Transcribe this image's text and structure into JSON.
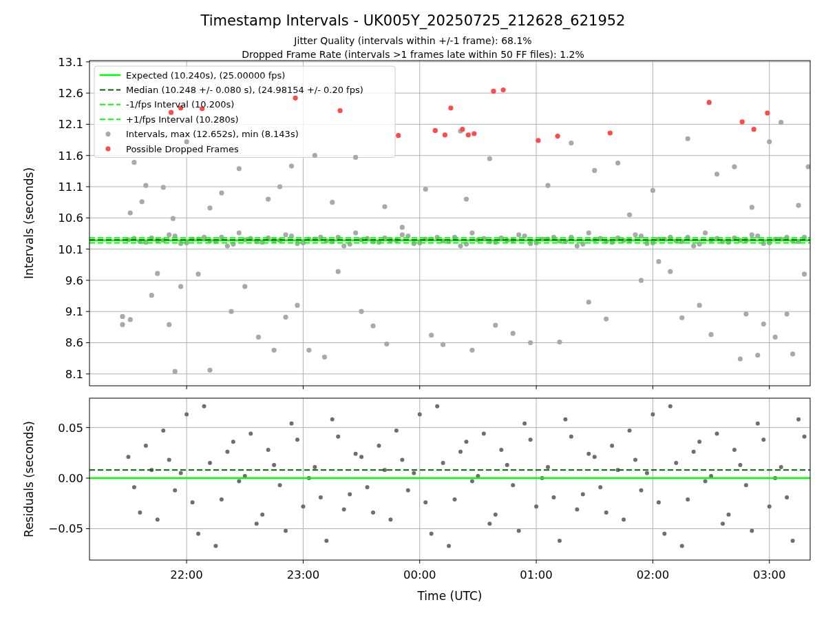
{
  "figure": {
    "title": "Timestamp Intervals - UK005Y_20250725_212628_621952",
    "subtitles": [
      "Jitter Quality (intervals within +/-1 frame): 68.1%",
      "Dropped Frame Rate (intervals >1 frames late within 50 FF files): 1.2%"
    ]
  },
  "charts": [
    {
      "chart_data": {
        "type": "scatter",
        "ylabel": "Intervals (seconds)",
        "grid": true,
        "legend": "upper left",
        "xlim": [
          "2025-07-25T21:10",
          "2025-07-26T03:21"
        ],
        "ylim": [
          7.91,
          13.12
        ],
        "yticks": [
          {
            "value": 8.1,
            "label": "8.1"
          },
          {
            "value": 8.6,
            "label": "8.6"
          },
          {
            "value": 9.1,
            "label": "9.1"
          },
          {
            "value": 9.6,
            "label": "9.6"
          },
          {
            "value": 10.1,
            "label": "10.1"
          },
          {
            "value": 10.6,
            "label": "10.6"
          },
          {
            "value": 11.1,
            "label": "11.1"
          },
          {
            "value": 11.6,
            "label": "11.6"
          },
          {
            "value": 12.1,
            "label": "12.1"
          },
          {
            "value": 12.6,
            "label": "12.6"
          },
          {
            "value": 13.1,
            "label": "13.1"
          }
        ],
        "ref_lines": [
          {
            "axis": "y",
            "value": 10.24,
            "label": "Expected (10.240s), (25.00000 fps)",
            "color": "#00ff00"
          },
          {
            "axis": "y",
            "value": 10.248,
            "label": "Median (10.248 +/- 0.080 s), (24.98154 +/- 0.20 fps)",
            "color": "#006400"
          },
          {
            "axis": "y",
            "value": 10.2,
            "label": "-1/fps Interval (10.200s)",
            "color": "#00ff00"
          },
          {
            "axis": "y",
            "value": 10.28,
            "label": "+1/fps Interval (10.280s)",
            "color": "#00ff00"
          }
        ],
        "series": [
          {
            "name": "Intervals, max (12.652s), min (8.143s)",
            "color": "#a9a9a9",
            "x": [
              "2025-07-25T21:27",
              "2025-07-25T21:27",
              "2025-07-25T21:31",
              "2025-07-25T21:31",
              "2025-07-25T21:33",
              "2025-07-25T21:37",
              "2025-07-25T21:39",
              "2025-07-25T21:42",
              "2025-07-25T21:45",
              "2025-07-25T21:48",
              "2025-07-25T21:51",
              "2025-07-25T21:53",
              "2025-07-25T21:54",
              "2025-07-25T21:57",
              "2025-07-25T22:00",
              "2025-07-25T22:06",
              "2025-07-25T22:12",
              "2025-07-25T22:12",
              "2025-07-25T22:18",
              "2025-07-25T22:23",
              "2025-07-25T22:27",
              "2025-07-25T22:30",
              "2025-07-25T22:37",
              "2025-07-25T22:42",
              "2025-07-25T22:45",
              "2025-07-25T22:48",
              "2025-07-25T22:51",
              "2025-07-25T22:54",
              "2025-07-25T22:57",
              "2025-07-25T23:03",
              "2025-07-25T23:06",
              "2025-07-25T23:11",
              "2025-07-25T23:15",
              "2025-07-25T23:18",
              "2025-07-25T23:27",
              "2025-07-25T23:30",
              "2025-07-25T23:36",
              "2025-07-25T23:42",
              "2025-07-25T23:43",
              "2025-07-25T23:51",
              "2025-07-26T00:03",
              "2025-07-26T00:06",
              "2025-07-26T00:12",
              "2025-07-26T00:21",
              "2025-07-26T00:24",
              "2025-07-26T00:27",
              "2025-07-26T00:36",
              "2025-07-26T00:39",
              "2025-07-26T00:48",
              "2025-07-26T00:57",
              "2025-07-26T01:06",
              "2025-07-26T01:12",
              "2025-07-26T01:18",
              "2025-07-26T01:27",
              "2025-07-26T01:30",
              "2025-07-26T01:36",
              "2025-07-26T01:42",
              "2025-07-26T01:48",
              "2025-07-26T01:54",
              "2025-07-26T02:00",
              "2025-07-26T02:03",
              "2025-07-26T02:09",
              "2025-07-26T02:15",
              "2025-07-26T02:18",
              "2025-07-26T02:24",
              "2025-07-26T02:30",
              "2025-07-26T02:33",
              "2025-07-26T02:42",
              "2025-07-26T02:45",
              "2025-07-26T02:48",
              "2025-07-26T02:51",
              "2025-07-26T02:54",
              "2025-07-26T02:57",
              "2025-07-26T03:00",
              "2025-07-26T03:03",
              "2025-07-26T03:06",
              "2025-07-26T03:09",
              "2025-07-26T03:12",
              "2025-07-26T03:15",
              "2025-07-26T03:18",
              "2025-07-26T03:20",
              "2025-07-25T21:30",
              "2025-07-25T21:36",
              "2025-07-25T21:42",
              "2025-07-25T21:48",
              "2025-07-25T21:54",
              "2025-07-25T22:00",
              "2025-07-25T22:06",
              "2025-07-25T22:12",
              "2025-07-25T22:18",
              "2025-07-25T22:24",
              "2025-07-25T22:30",
              "2025-07-25T22:36",
              "2025-07-25T22:42",
              "2025-07-25T22:48",
              "2025-07-25T22:54",
              "2025-07-25T23:00",
              "2025-07-25T23:06",
              "2025-07-25T23:12",
              "2025-07-25T23:18",
              "2025-07-25T23:24",
              "2025-07-25T23:30",
              "2025-07-25T23:36",
              "2025-07-25T23:42",
              "2025-07-25T23:48",
              "2025-07-25T23:54",
              "2025-07-26T00:00",
              "2025-07-26T00:06",
              "2025-07-26T00:12",
              "2025-07-26T00:18",
              "2025-07-26T00:24",
              "2025-07-26T00:30",
              "2025-07-26T00:36",
              "2025-07-26T00:42",
              "2025-07-26T00:48",
              "2025-07-26T00:54",
              "2025-07-26T01:00",
              "2025-07-26T01:06",
              "2025-07-26T01:12",
              "2025-07-26T01:18",
              "2025-07-26T01:24",
              "2025-07-26T01:30",
              "2025-07-26T01:36",
              "2025-07-26T01:42",
              "2025-07-26T01:48",
              "2025-07-26T01:54",
              "2025-07-26T02:00",
              "2025-07-26T02:06",
              "2025-07-26T02:12",
              "2025-07-26T02:18",
              "2025-07-26T02:24",
              "2025-07-26T02:30",
              "2025-07-26T02:36",
              "2025-07-26T02:42",
              "2025-07-26T02:48",
              "2025-07-26T02:54",
              "2025-07-26T03:00",
              "2025-07-26T03:06",
              "2025-07-26T03:12",
              "2025-07-26T03:18",
              "2025-07-25T21:33",
              "2025-07-25T21:39",
              "2025-07-25T21:45",
              "2025-07-25T21:51",
              "2025-07-25T21:57",
              "2025-07-25T22:03",
              "2025-07-25T22:09",
              "2025-07-25T22:15",
              "2025-07-25T22:21",
              "2025-07-25T22:27",
              "2025-07-25T22:33",
              "2025-07-25T22:39",
              "2025-07-25T22:45",
              "2025-07-25T22:51",
              "2025-07-25T22:57",
              "2025-07-25T23:03",
              "2025-07-25T23:09",
              "2025-07-25T23:15",
              "2025-07-25T23:21",
              "2025-07-25T23:27",
              "2025-07-25T23:33",
              "2025-07-25T23:39",
              "2025-07-25T23:45",
              "2025-07-25T23:51",
              "2025-07-25T23:57",
              "2025-07-26T00:03",
              "2025-07-26T00:09",
              "2025-07-26T00:15",
              "2025-07-26T00:21",
              "2025-07-26T00:27",
              "2025-07-26T00:33",
              "2025-07-26T00:39",
              "2025-07-26T00:45",
              "2025-07-26T00:51",
              "2025-07-26T00:57",
              "2025-07-26T01:03",
              "2025-07-26T01:09",
              "2025-07-26T01:15",
              "2025-07-26T01:21",
              "2025-07-26T01:27",
              "2025-07-26T01:33",
              "2025-07-26T01:39",
              "2025-07-26T01:45",
              "2025-07-26T01:51",
              "2025-07-26T01:57",
              "2025-07-26T02:03",
              "2025-07-26T02:09",
              "2025-07-26T02:15",
              "2025-07-26T02:21",
              "2025-07-26T02:27",
              "2025-07-26T02:33",
              "2025-07-26T02:39",
              "2025-07-26T02:45",
              "2025-07-26T02:51",
              "2025-07-26T02:57",
              "2025-07-26T03:03",
              "2025-07-26T03:09",
              "2025-07-26T03:15"
            ],
            "values": [
              9.02,
              8.89,
              8.97,
              10.68,
              11.49,
              10.86,
              11.12,
              9.36,
              9.71,
              11.09,
              8.89,
              10.59,
              8.14,
              9.5,
              11.82,
              9.7,
              8.16,
              10.76,
              11.0,
              9.1,
              11.39,
              9.5,
              8.69,
              10.9,
              8.48,
              11.1,
              9.01,
              11.43,
              9.2,
              8.48,
              11.6,
              8.37,
              10.85,
              9.74,
              11.57,
              9.1,
              8.87,
              10.78,
              8.58,
              10.45,
              11.06,
              8.72,
              8.57,
              11.99,
              10.9,
              8.48,
              11.55,
              8.88,
              8.75,
              8.6,
              11.12,
              8.61,
              11.8,
              9.25,
              11.36,
              8.98,
              11.48,
              10.65,
              9.6,
              11.04,
              9.9,
              9.74,
              9.0,
              11.87,
              9.2,
              8.73,
              11.3,
              11.42,
              8.34,
              9.06,
              10.77,
              8.4,
              8.9,
              11.82,
              8.69,
              12.13,
              9.06,
              8.42,
              10.8,
              9.7,
              11.42,
              10.25,
              10.22,
              10.28,
              10.24,
              10.31,
              10.2,
              10.26,
              10.23,
              10.29,
              10.18,
              10.25,
              10.22,
              10.28,
              10.24,
              10.31,
              10.2,
              10.26,
              10.23,
              10.29,
              10.18,
              10.25,
              10.22,
              10.28,
              10.24,
              10.31,
              10.2,
              10.26,
              10.23,
              10.29,
              10.18,
              10.25,
              10.22,
              10.28,
              10.24,
              10.31,
              10.2,
              10.26,
              10.23,
              10.29,
              10.18,
              10.25,
              10.22,
              10.28,
              10.24,
              10.31,
              10.2,
              10.26,
              10.23,
              10.29,
              10.18,
              10.25,
              10.22,
              10.28,
              10.24,
              10.31,
              10.2,
              10.26,
              10.23,
              10.29,
              10.27,
              10.21,
              10.24,
              10.33,
              10.19,
              10.26,
              10.29,
              10.22,
              10.15,
              10.36,
              10.27,
              10.21,
              10.24,
              10.33,
              10.19,
              10.26,
              10.29,
              10.22,
              10.15,
              10.36,
              10.27,
              10.21,
              10.24,
              10.33,
              10.19,
              10.26,
              10.29,
              10.22,
              10.15,
              10.36,
              10.27,
              10.21,
              10.24,
              10.33,
              10.19,
              10.26,
              10.29,
              10.22,
              10.15,
              10.36,
              10.27,
              10.21,
              10.24,
              10.33,
              10.19,
              10.26,
              10.29,
              10.22,
              10.15,
              10.36,
              10.27,
              10.21,
              10.24,
              10.33,
              10.19,
              10.26,
              10.29,
              10.22
            ]
          },
          {
            "name": "Possible Dropped Frames",
            "color": "#ff4a4a",
            "x": [
              "2025-07-25T21:52",
              "2025-07-25T21:57",
              "2025-07-25T22:08",
              "2025-07-25T22:56",
              "2025-07-25T23:19",
              "2025-07-25T23:49",
              "2025-07-26T00:08",
              "2025-07-26T00:13",
              "2025-07-26T00:16",
              "2025-07-26T00:22",
              "2025-07-26T00:25",
              "2025-07-26T00:28",
              "2025-07-26T00:38",
              "2025-07-26T00:43",
              "2025-07-26T01:01",
              "2025-07-26T01:11",
              "2025-07-26T01:38",
              "2025-07-26T02:29",
              "2025-07-26T02:46",
              "2025-07-26T02:52",
              "2025-07-26T02:59"
            ],
            "values": [
              12.29,
              12.36,
              12.35,
              12.52,
              12.32,
              11.92,
              12.0,
              11.93,
              12.36,
              12.02,
              11.93,
              11.95,
              12.63,
              12.65,
              11.84,
              11.91,
              11.96,
              12.45,
              12.14,
              12.02,
              12.28
            ]
          }
        ]
      }
    },
    {
      "chart_data": {
        "type": "scatter",
        "xlabel": "Time (UTC)",
        "ylabel": "Residuals (seconds)",
        "grid": true,
        "xlim": [
          "2025-07-25T21:10",
          "2025-07-26T03:21"
        ],
        "ylim": [
          -0.081,
          0.079
        ],
        "xticks": [
          {
            "value": "2025-07-25T22:00",
            "label": "22:00"
          },
          {
            "value": "2025-07-25T23:00",
            "label": "23:00"
          },
          {
            "value": "2025-07-26T00:00",
            "label": "00:00"
          },
          {
            "value": "2025-07-26T01:00",
            "label": "01:00"
          },
          {
            "value": "2025-07-26T02:00",
            "label": "02:00"
          },
          {
            "value": "2025-07-26T03:00",
            "label": "03:00"
          }
        ],
        "yticks": [
          {
            "value": -0.05,
            "label": "−0.05"
          },
          {
            "value": 0,
            "label": "0.00"
          },
          {
            "value": 0.05,
            "label": "0.05"
          }
        ],
        "ref_lines": [
          {
            "axis": "y",
            "value": 0,
            "color": "#00ff00"
          },
          {
            "axis": "y",
            "value": 0.008,
            "color": "#006400"
          }
        ],
        "series": [
          {
            "color": "#6e6e6e",
            "x": [
              "2025-07-25T21:30",
              "2025-07-25T21:36",
              "2025-07-25T21:42",
              "2025-07-25T21:48",
              "2025-07-25T21:54",
              "2025-07-25T22:00",
              "2025-07-25T22:06",
              "2025-07-25T22:12",
              "2025-07-25T22:18",
              "2025-07-25T22:24",
              "2025-07-25T22:30",
              "2025-07-25T22:36",
              "2025-07-25T22:42",
              "2025-07-25T22:48",
              "2025-07-25T22:54",
              "2025-07-25T23:00",
              "2025-07-25T23:06",
              "2025-07-25T23:12",
              "2025-07-25T23:18",
              "2025-07-25T23:24",
              "2025-07-25T23:30",
              "2025-07-25T23:36",
              "2025-07-25T23:42",
              "2025-07-25T23:48",
              "2025-07-25T23:54",
              "2025-07-26T00:00",
              "2025-07-26T00:06",
              "2025-07-26T00:12",
              "2025-07-26T00:18",
              "2025-07-26T00:24",
              "2025-07-26T00:30",
              "2025-07-26T00:36",
              "2025-07-26T00:42",
              "2025-07-26T00:48",
              "2025-07-26T00:54",
              "2025-07-26T01:00",
              "2025-07-26T01:06",
              "2025-07-26T01:12",
              "2025-07-26T01:18",
              "2025-07-26T01:24",
              "2025-07-26T01:30",
              "2025-07-26T01:36",
              "2025-07-26T01:42",
              "2025-07-26T01:48",
              "2025-07-26T01:54",
              "2025-07-26T02:00",
              "2025-07-26T02:06",
              "2025-07-26T02:12",
              "2025-07-26T02:18",
              "2025-07-26T02:24",
              "2025-07-26T02:30",
              "2025-07-26T02:36",
              "2025-07-26T02:42",
              "2025-07-26T02:48",
              "2025-07-26T02:54",
              "2025-07-26T03:00",
              "2025-07-26T03:06",
              "2025-07-26T03:12",
              "2025-07-26T03:18",
              "2025-07-25T21:33",
              "2025-07-25T21:39",
              "2025-07-25T21:45",
              "2025-07-25T21:51",
              "2025-07-25T21:57",
              "2025-07-25T22:03",
              "2025-07-25T22:09",
              "2025-07-25T22:15",
              "2025-07-25T22:21",
              "2025-07-25T22:27",
              "2025-07-25T22:33",
              "2025-07-25T22:39",
              "2025-07-25T22:45",
              "2025-07-25T22:51",
              "2025-07-25T22:57",
              "2025-07-25T23:03",
              "2025-07-25T23:09",
              "2025-07-25T23:15",
              "2025-07-25T23:21",
              "2025-07-25T23:27",
              "2025-07-25T23:33",
              "2025-07-25T23:39",
              "2025-07-25T23:45",
              "2025-07-25T23:51",
              "2025-07-25T23:57",
              "2025-07-26T00:03",
              "2025-07-26T00:09",
              "2025-07-26T00:15",
              "2025-07-26T00:21",
              "2025-07-26T00:27",
              "2025-07-26T00:33",
              "2025-07-26T00:39",
              "2025-07-26T00:45",
              "2025-07-26T00:51",
              "2025-07-26T00:57",
              "2025-07-26T01:03",
              "2025-07-26T01:09",
              "2025-07-26T01:15",
              "2025-07-26T01:21",
              "2025-07-26T01:27",
              "2025-07-26T01:33",
              "2025-07-26T01:39",
              "2025-07-26T01:45",
              "2025-07-26T01:51",
              "2025-07-26T01:57",
              "2025-07-26T02:03",
              "2025-07-26T02:09",
              "2025-07-26T02:15",
              "2025-07-26T02:21",
              "2025-07-26T02:27",
              "2025-07-26T02:33",
              "2025-07-26T02:39",
              "2025-07-26T02:45",
              "2025-07-26T02:51",
              "2025-07-26T02:57",
              "2025-07-26T03:03",
              "2025-07-26T03:09",
              "2025-07-26T03:15"
            ],
            "values": [
              0.021,
              -0.034,
              0.008,
              0.047,
              -0.012,
              0.063,
              -0.055,
              0.015,
              -0.021,
              0.036,
              0.002,
              -0.045,
              0.028,
              -0.007,
              0.054,
              -0.028,
              0.011,
              -0.062,
              0.041,
              -0.016,
              0.021,
              -0.034,
              0.008,
              0.047,
              -0.012,
              0.063,
              -0.055,
              0.015,
              -0.021,
              0.036,
              0.002,
              -0.045,
              0.028,
              -0.007,
              0.054,
              -0.028,
              0.011,
              -0.062,
              0.041,
              -0.016,
              0.021,
              -0.034,
              0.008,
              0.047,
              -0.012,
              0.063,
              -0.055,
              0.015,
              -0.021,
              0.036,
              0.002,
              -0.045,
              0.028,
              -0.007,
              0.054,
              -0.028,
              0.011,
              -0.062,
              0.041,
              -0.009,
              0.032,
              -0.041,
              0.018,
              0.005,
              -0.024,
              0.071,
              -0.067,
              0.026,
              -0.003,
              0.044,
              -0.036,
              0.013,
              -0.052,
              0.038,
              0.0,
              -0.019,
              0.058,
              -0.031,
              0.024,
              -0.009,
              0.032,
              -0.041,
              0.018,
              0.005,
              -0.024,
              0.071,
              -0.067,
              0.026,
              -0.003,
              0.044,
              -0.036,
              0.013,
              -0.052,
              0.038,
              0.0,
              -0.019,
              0.058,
              -0.031,
              0.024,
              -0.009,
              0.032,
              -0.041,
              0.018,
              0.005,
              -0.024,
              0.071,
              -0.067,
              0.026,
              -0.003,
              0.044,
              -0.036,
              0.013,
              -0.052,
              0.038,
              0.0,
              -0.019,
              0.058
            ]
          }
        ]
      }
    }
  ]
}
